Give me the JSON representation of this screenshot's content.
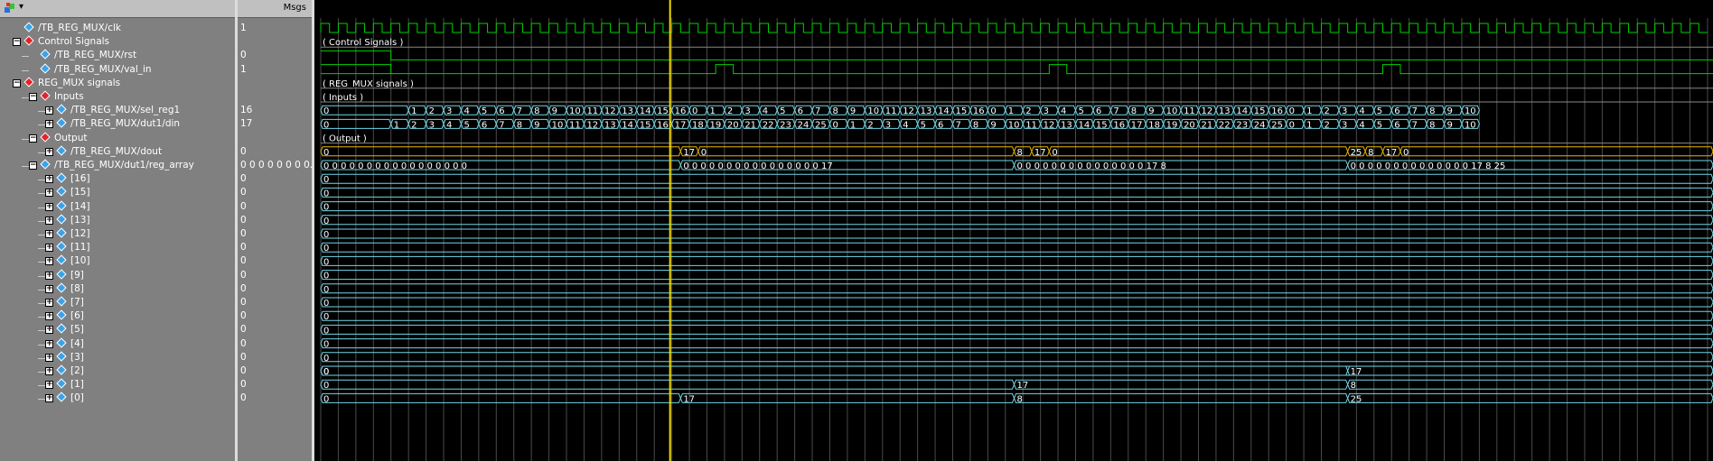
{
  "names_header": {
    "tool_icon": "wave-tool-icon",
    "dropdown": "▾"
  },
  "msgs_header": {
    "label": "Msgs"
  },
  "rows": [
    {
      "name": "/TB_REG_MUX/clk",
      "msg": "1",
      "kind": "sig",
      "depth": 0,
      "expand": ""
    },
    {
      "name": "Control Signals",
      "msg": "",
      "kind": "grp",
      "depth": 0,
      "expand": "-"
    },
    {
      "name": "/TB_REG_MUX/rst",
      "msg": "0",
      "kind": "sig",
      "depth": 1,
      "expand": ""
    },
    {
      "name": "/TB_REG_MUX/val_in",
      "msg": "1",
      "kind": "sig",
      "depth": 1,
      "expand": ""
    },
    {
      "name": "REG_MUX signals",
      "msg": "",
      "kind": "grp",
      "depth": 0,
      "expand": "-"
    },
    {
      "name": "Inputs",
      "msg": "",
      "kind": "grp",
      "depth": 1,
      "expand": "-"
    },
    {
      "name": "/TB_REG_MUX/sel_reg1",
      "msg": "16",
      "kind": "sig",
      "depth": 2,
      "expand": "+"
    },
    {
      "name": "/TB_REG_MUX/dut1/din",
      "msg": "17",
      "kind": "sig",
      "depth": 2,
      "expand": "+"
    },
    {
      "name": "Output",
      "msg": "",
      "kind": "grp",
      "depth": 1,
      "expand": "-"
    },
    {
      "name": "/TB_REG_MUX/dout",
      "msg": "0",
      "kind": "sig",
      "depth": 2,
      "expand": "+"
    },
    {
      "name": "/TB_REG_MUX/dut1/reg_array",
      "msg": "0 0 0 0 0 0 0 0...",
      "kind": "sig",
      "depth": 1,
      "expand": "-"
    },
    {
      "name": "[16]",
      "msg": "0",
      "kind": "sig",
      "depth": 2,
      "expand": "+"
    },
    {
      "name": "[15]",
      "msg": "0",
      "kind": "sig",
      "depth": 2,
      "expand": "+"
    },
    {
      "name": "[14]",
      "msg": "0",
      "kind": "sig",
      "depth": 2,
      "expand": "+"
    },
    {
      "name": "[13]",
      "msg": "0",
      "kind": "sig",
      "depth": 2,
      "expand": "+"
    },
    {
      "name": "[12]",
      "msg": "0",
      "kind": "sig",
      "depth": 2,
      "expand": "+"
    },
    {
      "name": "[11]",
      "msg": "0",
      "kind": "sig",
      "depth": 2,
      "expand": "+"
    },
    {
      "name": "[10]",
      "msg": "0",
      "kind": "sig",
      "depth": 2,
      "expand": "+"
    },
    {
      "name": "[9]",
      "msg": "0",
      "kind": "sig",
      "depth": 2,
      "expand": "+"
    },
    {
      "name": "[8]",
      "msg": "0",
      "kind": "sig",
      "depth": 2,
      "expand": "+"
    },
    {
      "name": "[7]",
      "msg": "0",
      "kind": "sig",
      "depth": 2,
      "expand": "+"
    },
    {
      "name": "[6]",
      "msg": "0",
      "kind": "sig",
      "depth": 2,
      "expand": "+"
    },
    {
      "name": "[5]",
      "msg": "0",
      "kind": "sig",
      "depth": 2,
      "expand": "+"
    },
    {
      "name": "[4]",
      "msg": "0",
      "kind": "sig",
      "depth": 2,
      "expand": "+"
    },
    {
      "name": "[3]",
      "msg": "0",
      "kind": "sig",
      "depth": 2,
      "expand": "+"
    },
    {
      "name": "[2]",
      "msg": "0",
      "kind": "sig",
      "depth": 2,
      "expand": "+"
    },
    {
      "name": "[1]",
      "msg": "0",
      "kind": "sig",
      "depth": 2,
      "expand": "+"
    },
    {
      "name": "[0]",
      "msg": "0",
      "kind": "sig",
      "depth": 2,
      "expand": "+"
    }
  ],
  "group_labels": {
    "control": "( Control Signals )",
    "regmux": "( REG_MUX signals )",
    "inputs": "( Inputs )",
    "output": "( Output )"
  },
  "waves": {
    "clk_cycles": 79,
    "rst_low_at_cycle": 4,
    "val_in_pulses": [
      {
        "start": 22.5,
        "end": 23.5
      },
      {
        "start": 41.5,
        "end": 42.5
      },
      {
        "start": 60.5,
        "end": 61.5
      }
    ],
    "sel_reg1": [
      "0",
      "1",
      "2",
      "3",
      "4",
      "5",
      "6",
      "7",
      "8",
      "9",
      "10",
      "11",
      "12",
      "13",
      "14",
      "15",
      "16",
      "0",
      "1",
      "2",
      "3",
      "4",
      "5",
      "6",
      "7",
      "8",
      "9",
      "10",
      "11",
      "12",
      "13",
      "14",
      "15",
      "16",
      "0",
      "1",
      "2",
      "3",
      "4",
      "5",
      "6",
      "7",
      "8",
      "9",
      "10",
      "11",
      "12",
      "13",
      "14",
      "15",
      "16",
      "0",
      "1",
      "2",
      "3",
      "4",
      "5",
      "6",
      "7",
      "8",
      "9",
      "10"
    ],
    "din": [
      "0",
      "1",
      "2",
      "3",
      "4",
      "5",
      "6",
      "7",
      "8",
      "9",
      "10",
      "11",
      "12",
      "13",
      "14",
      "15",
      "16",
      "17",
      "18",
      "19",
      "20",
      "21",
      "22",
      "23",
      "24",
      "25",
      "0",
      "1",
      "2",
      "3",
      "4",
      "5",
      "6",
      "7",
      "8",
      "9",
      "10",
      "11",
      "12",
      "13",
      "14",
      "15",
      "16",
      "17",
      "18",
      "19",
      "20",
      "21",
      "22",
      "23",
      "24",
      "25",
      "0",
      "1",
      "2",
      "3",
      "4",
      "5",
      "6",
      "7",
      "8",
      "9",
      "10"
    ],
    "dout_segments": [
      {
        "label": "0"
      },
      {
        "label": "17"
      },
      {
        "label": "0"
      },
      {
        "label": "8"
      },
      {
        "label": "17"
      },
      {
        "label": "0"
      },
      {
        "label": "25"
      },
      {
        "label": "8"
      },
      {
        "label": "17"
      },
      {
        "label": "0"
      }
    ],
    "reg_array_values": [
      "0 0 0 0 0 0 0 0 0 0 0 0 0 0 0 0 0",
      "0 0 0 0 0 0 0 0 0 0 0 0 0 0 0 0 17",
      "0 0 0 0 0 0 0 0 0 0 0 0 0 0 0 17 8",
      "0 0 0 0 0 0 0 0 0 0 0 0 0 0 17 8 25"
    ],
    "reg2_values": [
      "0",
      "17"
    ],
    "reg1_values": [
      "0",
      "17",
      "8"
    ],
    "reg0_values": [
      "0",
      "17",
      "8",
      "25"
    ]
  },
  "colors": {
    "clk": "#00d000",
    "bus": "#6fd8e8",
    "dout": "#e8b400",
    "cursor": "#f2dc00",
    "grid": "#4a4a4a",
    "text": "#ffffff"
  }
}
